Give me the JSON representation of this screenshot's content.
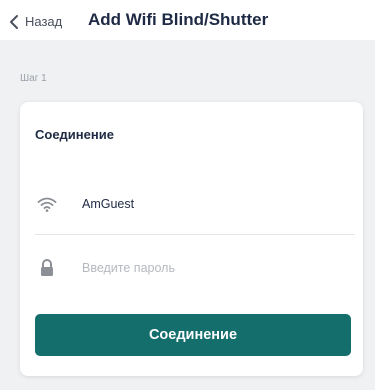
{
  "header": {
    "back_label": "Назад",
    "title": "Add Wifi Blind/Shutter"
  },
  "step_label": "Шаг 1",
  "card": {
    "title": "Соединение",
    "wifi_network": "AmGuest",
    "password_placeholder": "Введите пароль",
    "password_value": "",
    "connect_button": "Соединение"
  },
  "icons": {
    "back": "chevron-left-icon",
    "wifi": "wifi-icon",
    "password": "lock-icon"
  },
  "colors": {
    "accent": "#146e6c",
    "background": "#f0f1f3",
    "text": "#1f2a44",
    "icon": "#8c9096"
  }
}
